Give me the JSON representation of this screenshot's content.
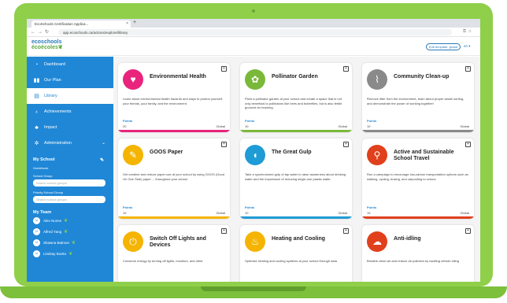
{
  "browser": {
    "tab_title": "EcoSchools Certification Applica...",
    "url": "app.ecoschools.ca/actions/explore/library"
  },
  "header": {
    "logo_line1": "ecoschools",
    "logo_line2": "écoécoles",
    "edit_template_button": "Edit template: global",
    "language": "en"
  },
  "sidebar": {
    "items": [
      {
        "label": "Dashboard",
        "icon": "dashboard-icon"
      },
      {
        "label": "Our Plan",
        "icon": "plan-icon"
      },
      {
        "label": "Library",
        "icon": "book-icon",
        "active": true
      },
      {
        "label": "Achievements",
        "icon": "ribbon-icon"
      },
      {
        "label": "Impact",
        "icon": "sprout-icon"
      },
      {
        "label": "Administration",
        "icon": "gear-icon"
      }
    ],
    "my_school": {
      "title": "My School",
      "school_label": "Guidebook",
      "school_group_label": "School Group",
      "school_group_placeholder": "Search school groups",
      "priority_group_label": "Priority School Group",
      "priority_group_placeholder": "Search school groups"
    },
    "my_team": {
      "title": "My Team",
      "members": [
        "Alex Nunes",
        "Alfred Yang",
        "Shawna Batmon",
        "Lindsay Busko"
      ]
    }
  },
  "cards": [
    {
      "title": "Environmental Health",
      "desc": "Learn about environmental health hazards and ways to protect yourself, your friends, your family, and the environment.",
      "points_label": "Points",
      "points": "20",
      "scope": "Global",
      "color": "#e8247c",
      "icon": "globe-heart-icon"
    },
    {
      "title": "Pollinator Garden",
      "desc": "Plant a pollinator garden at your school and create a space that is not only beneficial to pollinators like bees and butterflies, but is also fertile grounds for learning.",
      "points_label": "Points",
      "points": "10",
      "scope": "Global",
      "color": "#7ab83a",
      "icon": "bee-icon"
    },
    {
      "title": "Community Clean-up",
      "desc": "Remove litter from the environment, learn about proper waste sorting, and demonstrate the power of working together!",
      "points_label": "Points",
      "points": "10",
      "scope": "Global",
      "color": "#8a8a8a",
      "icon": "broom-icon"
    },
    {
      "title": "GOOS Paper",
      "desc": "Get creative and reduce paper use at your school by using GOOS (Good On One Side) paper ... throughout your school.",
      "points_label": "Points",
      "points": "10",
      "scope": "Global",
      "color": "#f4b400",
      "icon": "paper-icon"
    },
    {
      "title": "The Great Gulp",
      "desc": "Take a synchronized gulp of tap water to raise awareness about drinking water and the importance of reducing single-use plastic water.",
      "points_label": "Points",
      "points": "10",
      "scope": "Global",
      "color": "#1f9bd6",
      "icon": "faucet-icon"
    },
    {
      "title": "Active and Sustainable School Travel",
      "desc": "Run a campaign to encourage low-carbon transportation options such as walking, cycling, busing, and carpooling to school.",
      "points_label": "Points",
      "points": "15",
      "scope": "Global",
      "color": "#e0401c",
      "icon": "bicycle-icon"
    },
    {
      "title": "Switch Off Lights and Devices",
      "desc": "Conserve energy by turning off lights, monitors, and other",
      "points_label": "Points",
      "points": "",
      "scope": "",
      "color": "#f4b400",
      "icon": "plug-icon"
    },
    {
      "title": "Heating and Cooling",
      "desc": "Optimize heating and cooling systems at your school through data",
      "points_label": "Points",
      "points": "",
      "scope": "",
      "color": "#f4b400",
      "icon": "flame-icon"
    },
    {
      "title": "Anti-idling",
      "desc": "Breathe clean air and reduce air pollution by tackling vehicle idling",
      "points_label": "Points",
      "points": "",
      "scope": "",
      "color": "#e0401c",
      "icon": "cloud-icon"
    }
  ]
}
